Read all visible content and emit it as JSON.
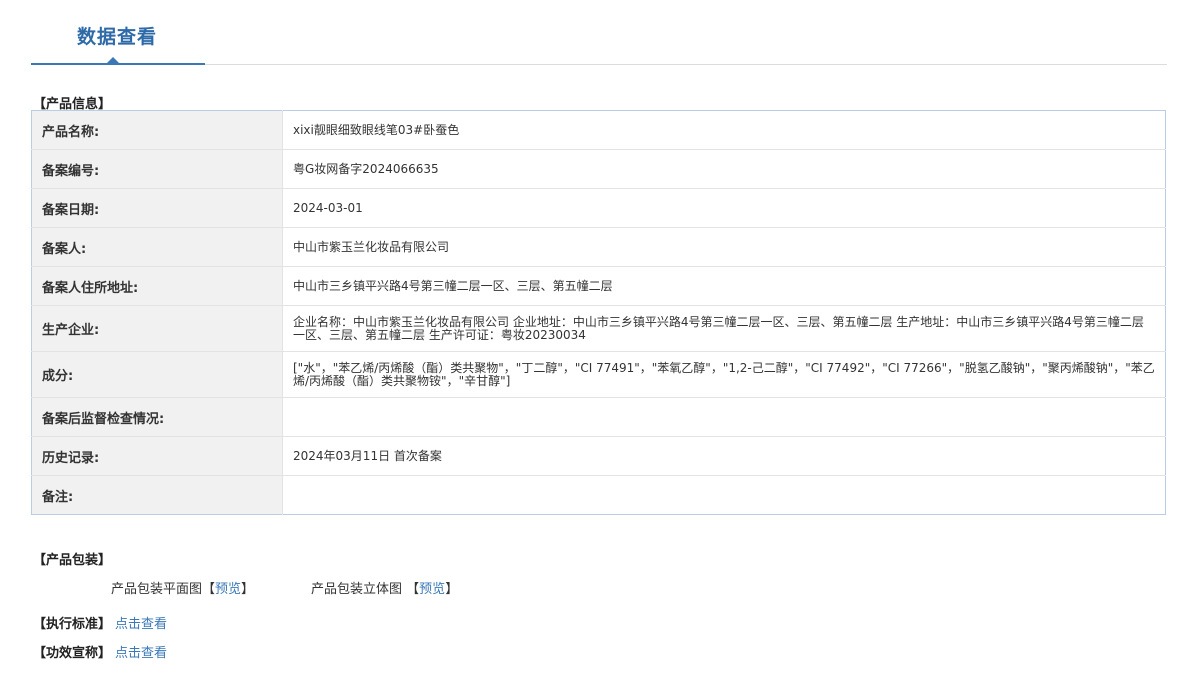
{
  "tab": {
    "title": "数据查看"
  },
  "product_info": {
    "section_label": "【产品信息】",
    "rows": [
      {
        "label": "产品名称:",
        "value": "xixi靓眼细致眼线笔03#卧蚕色"
      },
      {
        "label": "备案编号:",
        "value": "粤G妆网备字2024066635"
      },
      {
        "label": "备案日期:",
        "value": "2024-03-01"
      },
      {
        "label": "备案人:",
        "value": "中山市紫玉兰化妆品有限公司"
      },
      {
        "label": "备案人住所地址:",
        "value": "中山市三乡镇平兴路4号第三幢二层一区、三层、第五幢二层"
      },
      {
        "label": "生产企业:",
        "value": "企业名称：中山市紫玉兰化妆品有限公司 企业地址：中山市三乡镇平兴路4号第三幢二层一区、三层、第五幢二层 生产地址：中山市三乡镇平兴路4号第三幢二层一区、三层、第五幢二层 生产许可证：粤妆20230034"
      },
      {
        "label": "成分:",
        "value": "[\"水\"，\"苯乙烯/丙烯酸（酯）类共聚物\"，\"丁二醇\"，\"CI 77491\"，\"苯氧乙醇\"，\"1,2-己二醇\"，\"CI 77492\"，\"CI 77266\"，\"脱氢乙酸钠\"，\"聚丙烯酸钠\"，\"苯乙烯/丙烯酸（酯）类共聚物铵\"，\"辛甘醇\"]"
      },
      {
        "label": "备案后监督检查情况:",
        "value": ""
      },
      {
        "label": "历史记录:",
        "value": "2024年03月11日 首次备案"
      },
      {
        "label": "备注:",
        "value": ""
      }
    ]
  },
  "packaging": {
    "section_label": "【产品包装】",
    "flat_label": "产品包装平面图",
    "stereo_label": "产品包装立体图",
    "bracket_open": "【",
    "bracket_close": "】",
    "preview_link": "预览"
  },
  "standard": {
    "label": "【执行标准】",
    "link": "点击查看"
  },
  "efficacy": {
    "label": "【功效宣称】",
    "link": "点击查看"
  }
}
